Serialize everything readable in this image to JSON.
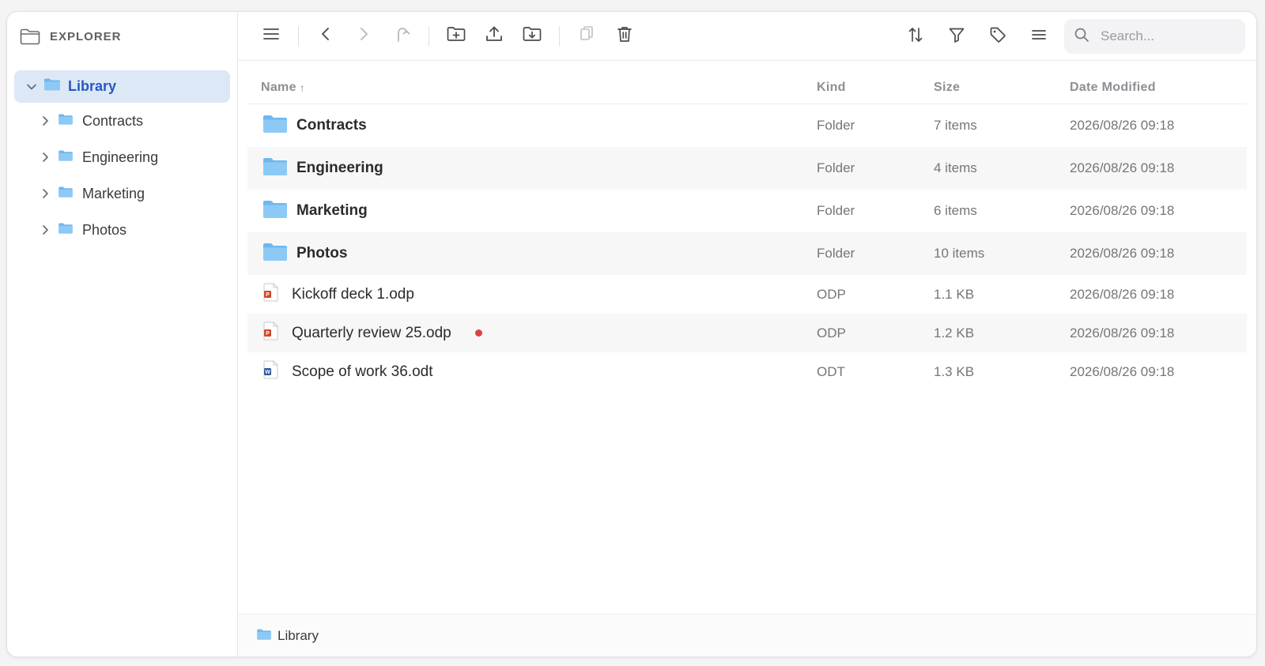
{
  "sidebar": {
    "title": "EXPLORER",
    "icon": "folder-outline-icon",
    "root": {
      "label": "Library",
      "expanded": true
    },
    "items": [
      {
        "label": "Contracts"
      },
      {
        "label": "Engineering"
      },
      {
        "label": "Marketing"
      },
      {
        "label": "Photos"
      }
    ]
  },
  "toolbar": {
    "buttons_left": [
      "menu-icon",
      "back-icon",
      "forward-icon",
      "up-icon",
      "new-folder-icon",
      "upload-icon",
      "download-icon",
      "copy-icon",
      "trash-icon"
    ],
    "buttons_right": [
      "sort-icon",
      "filter-icon",
      "tag-icon",
      "list-view-icon"
    ],
    "search_placeholder": "Search..."
  },
  "columns": {
    "name": "Name",
    "name_sort": "↑",
    "kind": "Kind",
    "size": "Size",
    "date": "Date Modified"
  },
  "rows": [
    {
      "name": "Contracts",
      "kind": "Folder",
      "size": "7 items",
      "date": "2026/08/26 09:18",
      "type": "folder"
    },
    {
      "name": "Engineering",
      "kind": "Folder",
      "size": "4 items",
      "date": "2026/08/26 09:18",
      "type": "folder"
    },
    {
      "name": "Marketing",
      "kind": "Folder",
      "size": "6 items",
      "date": "2026/08/26 09:18",
      "type": "folder"
    },
    {
      "name": "Photos",
      "kind": "Folder",
      "size": "10 items",
      "date": "2026/08/26 09:18",
      "type": "folder"
    },
    {
      "name": "Kickoff deck 1.odp",
      "kind": "ODP",
      "size": "1.1 KB",
      "date": "2026/08/26 09:18",
      "type": "presentation",
      "badge": "P"
    },
    {
      "name": "Quarterly review 25.odp",
      "kind": "ODP",
      "size": "1.2 KB",
      "date": "2026/08/26 09:18",
      "type": "presentation",
      "badge": "P",
      "modified_dot": true
    },
    {
      "name": "Scope of work 36.odt",
      "kind": "ODT",
      "size": "1.3 KB",
      "date": "2026/08/26 09:18",
      "type": "document",
      "badge": "W"
    }
  ],
  "statusbar": {
    "path": "Library"
  },
  "colors": {
    "accent": "#2458c4",
    "selection": "#dde8f7",
    "folder": "#7cc0f2",
    "presentation_badge": "#d24726",
    "document_badge": "#2b5797",
    "modified_dot": "#d9443c"
  }
}
